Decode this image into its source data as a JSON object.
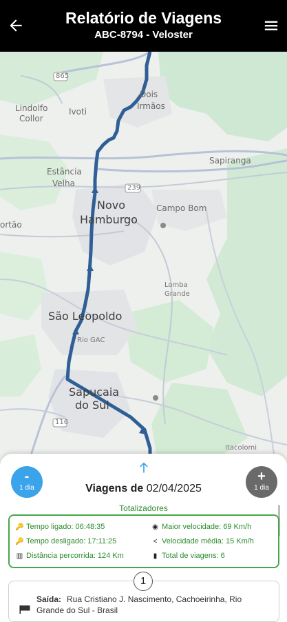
{
  "header": {
    "title": "Relatório de Viagens",
    "subtitle": "ABC-8794 - Veloster"
  },
  "map": {
    "labels": {
      "lindolfo_collor_1": "Lindolfo",
      "lindolfo_collor_2": "Collor",
      "ivoti": "Ivoti",
      "dois_irmaos_1": "Dois",
      "dois_irmaos_2": "Irmãos",
      "sapiranga": "Sapiranga",
      "estancia_velha_1": "Estância",
      "estancia_velha_2": "Velha",
      "novo_hamburgo_1": "Novo",
      "novo_hamburgo_2": "Hamburgo",
      "campo_bom": "Campo Bom",
      "portao": "ortão",
      "lomba_grande_1": "Lomba",
      "lomba_grande_2": "Grande",
      "sao_leopoldo": "São Leopoldo",
      "rio_gac": "Rio GAC",
      "sapucaia_1": "Sapucaia",
      "sapucaia_2": "do Sul",
      "itacolomi": "Itacolomi",
      "shield_865": "865",
      "shield_239": "239",
      "shield_116": "116"
    }
  },
  "panel": {
    "minus_sign": "-",
    "minus_label": "1 dia",
    "plus_sign": "+",
    "plus_label": "1 dia",
    "trips_of_label": "Viagens de",
    "trips_date": "02/04/2025",
    "totals_title": "Totalizadores",
    "totals": {
      "engine_on": "Tempo ligado: 06:48:35",
      "engine_off": "Tempo desligado: 17:11:25",
      "distance": "Distância percorrida: 124 Km",
      "max_speed": "Maior velocidade: 69 Km/h",
      "avg_speed": "Velocidade média: 15 Km/h",
      "total_trips": "Total de viagens: 6"
    },
    "trip_number": "1",
    "departure_label": "Saída:",
    "departure_address": "Rua Cristiano J. Nascimento, Cachoeirinha, Rio Grande do Sul - Brasil"
  },
  "colors": {
    "header_bg": "#000000",
    "route": "#2f5f95",
    "accent_blue": "#3aa3ea",
    "green": "#2e8b2e",
    "gray_button": "#6a6a6a"
  }
}
